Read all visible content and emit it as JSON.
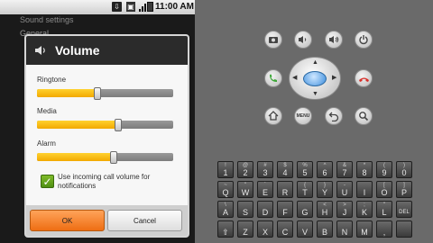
{
  "statusbar": {
    "time": "11:00 AM",
    "icons": [
      "usb-icon",
      "sim-icon",
      "signal-icon",
      "battery-icon"
    ]
  },
  "background": {
    "title": "Sound settings",
    "subtitle": "General"
  },
  "dialog": {
    "title": "Volume",
    "sections": [
      {
        "label": "Ringtone",
        "level": 0.43
      },
      {
        "label": "Media",
        "level": 0.58
      },
      {
        "label": "Alarm",
        "level": 0.55
      }
    ],
    "checkbox": {
      "label": "Use incoming call volume for notifications",
      "checked": true
    },
    "ok_label": "OK",
    "cancel_label": "Cancel"
  },
  "controls": {
    "menu_label": "MENU",
    "top_row": [
      "camera-icon",
      "volume-down-icon",
      "volume-up-icon",
      "power-icon"
    ]
  },
  "keyboard": {
    "rows": [
      [
        [
          "!",
          "1"
        ],
        [
          "@",
          "2"
        ],
        [
          "#",
          "3"
        ],
        [
          "$",
          "4"
        ],
        [
          "%",
          "5"
        ],
        [
          "^",
          "6"
        ],
        [
          "&",
          "7"
        ],
        [
          "*",
          "8"
        ],
        [
          "(",
          "9"
        ],
        [
          ")",
          "0"
        ]
      ],
      [
        [
          "~",
          "Q"
        ],
        [
          "\"",
          "W"
        ],
        [
          "´",
          "E"
        ],
        [
          "",
          "R"
        ],
        [
          "{",
          "T"
        ],
        [
          "}",
          "Y"
        ],
        [
          "-",
          "U"
        ],
        [
          "",
          "I"
        ],
        [
          "[",
          "O"
        ],
        [
          "]",
          "P"
        ]
      ],
      [
        [
          "\\",
          "A"
        ],
        [
          "",
          "S"
        ],
        [
          "",
          "D"
        ],
        [
          "",
          "F"
        ],
        [
          "",
          "G"
        ],
        [
          "<",
          "H"
        ],
        [
          ">",
          "J"
        ],
        [
          ";",
          "K"
        ],
        [
          "\"",
          "L"
        ],
        [
          "",
          "DEL"
        ]
      ],
      [
        [
          "",
          "⇧"
        ],
        [
          "",
          "Z"
        ],
        [
          "",
          "X"
        ],
        [
          "",
          "C"
        ],
        [
          "",
          "V"
        ],
        [
          "",
          "B"
        ],
        [
          "",
          "N"
        ],
        [
          "",
          "M"
        ],
        [
          "",
          ","
        ],
        [
          "",
          ""
        ]
      ]
    ]
  },
  "colors": {
    "accent": "#f2a900",
    "ok_button": "#ee6e13",
    "dpad_center": "#3b8ddd",
    "call_green": "#3aa635",
    "end_red": "#d8302a"
  }
}
